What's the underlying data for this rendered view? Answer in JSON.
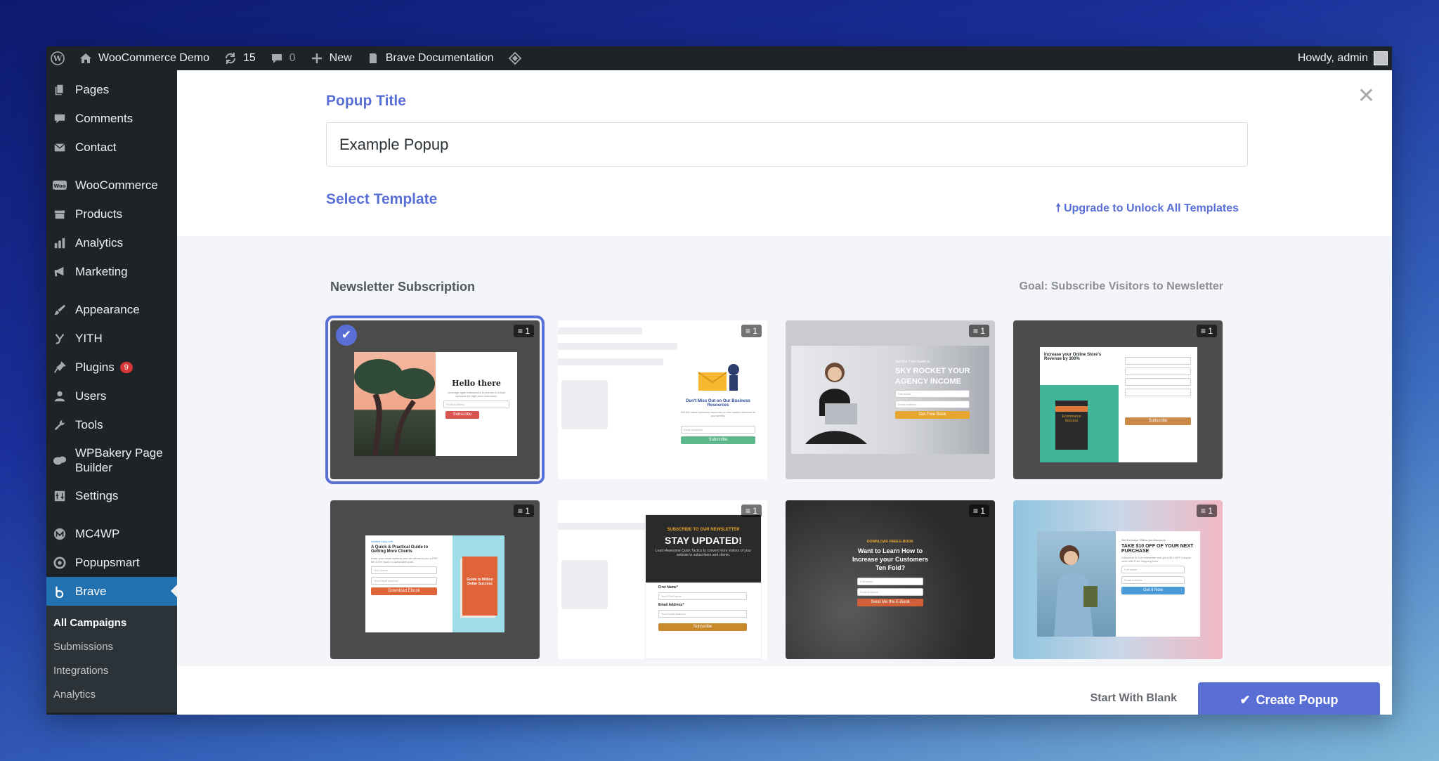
{
  "adminbar": {
    "site_name": "WooCommerce Demo",
    "updates_count": "15",
    "comments_count": "0",
    "new_label": "New",
    "docs_label": "Brave Documentation",
    "howdy": "Howdy, admin"
  },
  "sidebar": {
    "items": [
      {
        "label": "Pages",
        "icon": "pages-icon"
      },
      {
        "label": "Comments",
        "icon": "comments-icon"
      },
      {
        "label": "Contact",
        "icon": "mail-icon"
      },
      {
        "label": "WooCommerce",
        "icon": "woo-icon"
      },
      {
        "label": "Products",
        "icon": "products-icon"
      },
      {
        "label": "Analytics",
        "icon": "analytics-icon"
      },
      {
        "label": "Marketing",
        "icon": "megaphone-icon"
      },
      {
        "label": "Appearance",
        "icon": "brush-icon"
      },
      {
        "label": "YITH",
        "icon": "yith-icon"
      },
      {
        "label": "Plugins",
        "icon": "plugin-icon",
        "badge": "9"
      },
      {
        "label": "Users",
        "icon": "user-icon"
      },
      {
        "label": "Tools",
        "icon": "wrench-icon"
      },
      {
        "label": "WPBakery Page Builder",
        "icon": "wpbakery-icon"
      },
      {
        "label": "Settings",
        "icon": "settings-icon"
      },
      {
        "label": "MC4WP",
        "icon": "mc4wp-icon"
      },
      {
        "label": "Popupsmart",
        "icon": "popupsmart-icon"
      },
      {
        "label": "Brave",
        "icon": "brave-icon"
      }
    ],
    "submenu": [
      "All Campaigns",
      "Submissions",
      "Integrations",
      "Analytics"
    ]
  },
  "modal": {
    "popup_title_label": "Popup Title",
    "popup_title_value": "Example Popup",
    "select_template_label": "Select Template",
    "upgrade_label": "Upgrade to Unlock All Templates",
    "category_title": "Newsletter Subscription",
    "goal_label": "Goal: Subscribe Visitors to Newsletter",
    "layer_count": "1",
    "templates": {
      "t1": {
        "heading": "Hello there",
        "body": "Leverage agile frameworks to provide a robust synopsis for high level overviews.",
        "field": "Email Address",
        "button": "Subscribe"
      },
      "t2": {
        "heading": "Don't Miss Out on Our Business Resources",
        "body": "Get the latest business resources on the market delivered to you weekly.",
        "field": "Email Address*",
        "button": "Subscribe"
      },
      "t3": {
        "pre": "Get Our Free Guide to",
        "heading": "SKY ROCKET YOUR AGENCY INCOME",
        "field1": "Full Name",
        "field2": "Email Address",
        "button": "Get Free Book"
      },
      "t4": {
        "heading": "Increase your Online Store's Revenue by 300%",
        "book": "Ecommerce Success",
        "button": "Subscribe"
      },
      "t5": {
        "pre": "Limited Copy Left",
        "heading": "A Quick & Practical Guide to Getting More Clients",
        "body": "Enter your email address and we will send you a PDF file a free book on actionable puts.",
        "field1": "Your Name",
        "field2": "Your Email Address",
        "button": "Download Ebook",
        "book": "Guide to Million Dollar Success"
      },
      "t6": {
        "pre": "SUBSCRIBE TO OUR NEWSLETTER",
        "heading": "STAY UPDATED!",
        "body": "Learn Awesome Quick Tactics to convert more visitors of your website to subscribers and clients.",
        "label1": "First Name*",
        "field1": "Your First Name",
        "label2": "Email Address*",
        "field2": "Your Email Address",
        "button": "Subscribe"
      },
      "t7": {
        "pre": "DOWNLOAD FREE E-BOOK",
        "heading": "Want to Learn How to Increase your Customers Ten Fold?",
        "field1": "Full Name",
        "field2": "Email Address",
        "button": "Send Me the E-Book"
      },
      "t8": {
        "pre": "Get Exclusive Offers and Discounts",
        "heading": "TAKE $10 OFF OF YOUR NEXT PURCHASE",
        "body": "Subscribe to Our newsletter and get a $10 OFF Coupon code with Free Shipping Now",
        "field1": "Full Name",
        "field2": "Email address",
        "button": "Get it Now"
      }
    }
  },
  "footer": {
    "start_blank": "Start With Blank",
    "create_popup": "Create Popup"
  },
  "colors": {
    "accent": "#5a6fd6",
    "wp_dark": "#1d2327",
    "wp_blue": "#2271b1",
    "badge_red": "#d63638"
  }
}
